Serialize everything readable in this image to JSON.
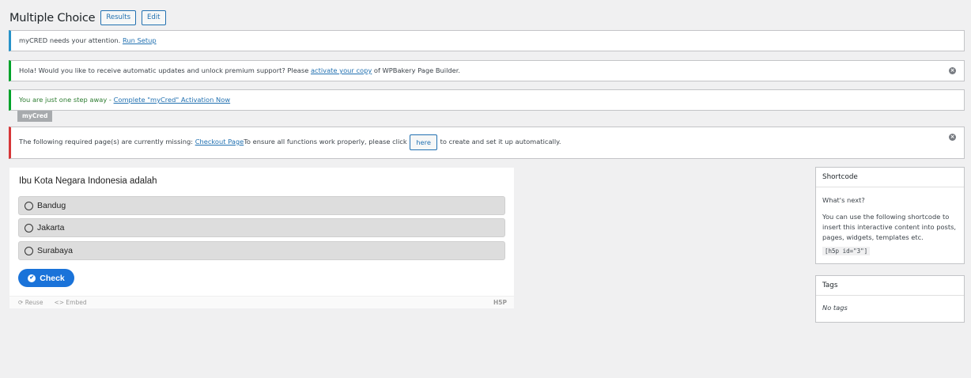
{
  "header": {
    "title": "Multiple Choice",
    "results_label": "Results",
    "edit_label": "Edit"
  },
  "notices": {
    "mycred_setup": {
      "text": "myCRED needs your attention.",
      "link": "Run Setup"
    },
    "wpbakery": {
      "text_before": "Hola! Would you like to receive automatic updates and unlock premium support? Please",
      "link": "activate your copy",
      "text_after": "of WPBakery Page Builder.",
      "dismiss_icon": "⊗"
    },
    "mycred_activation": {
      "text": "You are just one step away -",
      "link": "Complete \"myCred\" Activation Now",
      "tag": "myCred"
    },
    "missing_page": {
      "text_before": "The following required page(s) are currently missing:",
      "link": "Checkout Page",
      "text_mid": "To ensure all functions work properly, please click",
      "button": "here",
      "text_after": "to create and set it up automatically.",
      "dismiss_icon": "⊗"
    }
  },
  "h5p": {
    "question": "Ibu Kota Negara Indonesia adalah",
    "answers": [
      "Bandug",
      "Jakarta",
      "Surabaya"
    ],
    "check_label": "Check",
    "footer": {
      "reuse": "Reuse",
      "embed": "Embed",
      "logo": "H5P"
    }
  },
  "sidebar": {
    "shortcode": {
      "title": "Shortcode",
      "whats_next": "What's next?",
      "description": "You can use the following shortcode to insert this interactive content into posts, pages, widgets, templates etc.",
      "code": "[h5p id=\"3\"]"
    },
    "tags": {
      "title": "Tags",
      "empty": "No tags"
    }
  },
  "colors": {
    "accent": "#2271b1",
    "check_button": "#1a73d9",
    "notice_info": "#2793c9",
    "notice_success": "#00a32a",
    "notice_error": "#d63638"
  }
}
